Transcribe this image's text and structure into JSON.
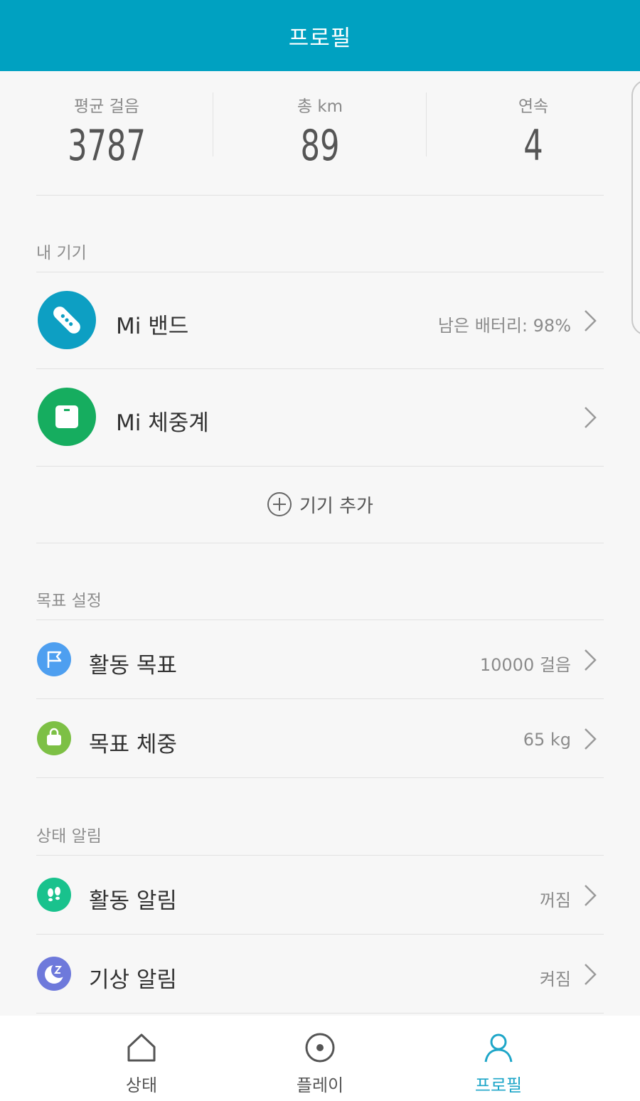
{
  "header": {
    "title": "프로필"
  },
  "stats": [
    {
      "label": "평균 걸음",
      "value": "3787"
    },
    {
      "label": "총 km",
      "value": "89"
    },
    {
      "label": "연속",
      "value": "4"
    }
  ],
  "devices": {
    "section_title": "내 기기",
    "items": [
      {
        "name": "Mi 밴드",
        "status": "남은 배터리: 98%",
        "icon": "band-icon",
        "color": "#0d9fc3"
      },
      {
        "name": "Mi 체중계",
        "status": "",
        "icon": "scale-icon",
        "color": "#16ad5f"
      }
    ],
    "add_label": "기기 추가"
  },
  "goals": {
    "section_title": "목표 설정",
    "items": [
      {
        "name": "활동 목표",
        "value": "10000 걸음",
        "icon": "flag-icon",
        "color": "#4e9ff0"
      },
      {
        "name": "목표 체중",
        "value": "65 kg",
        "icon": "weight-bag-icon",
        "color": "#7dc045"
      }
    ]
  },
  "alerts": {
    "section_title": "상태 알림",
    "items": [
      {
        "name": "활동 알림",
        "value": "꺼짐",
        "icon": "footprints-icon",
        "color": "#19c28d"
      },
      {
        "name": "기상 알림",
        "value": "켜짐",
        "icon": "moon-sleep-icon",
        "color": "#6e79db"
      }
    ]
  },
  "tabbar": {
    "tabs": [
      {
        "label": "상태",
        "icon": "home-icon",
        "active": false
      },
      {
        "label": "플레이",
        "icon": "play-target-icon",
        "active": false
      },
      {
        "label": "프로필",
        "icon": "profile-icon",
        "active": true
      }
    ],
    "active_color": "#1ea6c8"
  },
  "colors": {
    "header": "#00a1c1",
    "background": "#f7f7f7"
  }
}
